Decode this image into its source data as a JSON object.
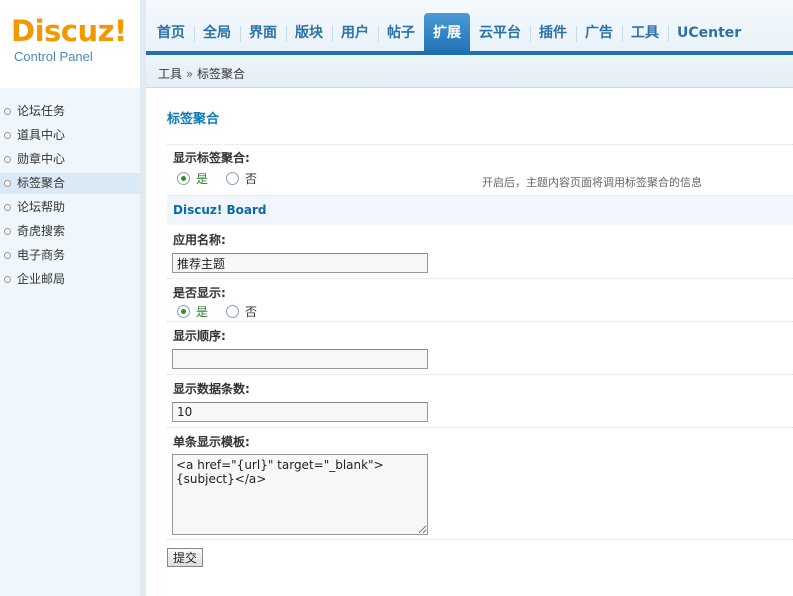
{
  "logo": {
    "word": "Discuz!",
    "sub": "Control Panel"
  },
  "nav": {
    "items": [
      {
        "label": "首页"
      },
      {
        "label": "全局"
      },
      {
        "label": "界面"
      },
      {
        "label": "版块"
      },
      {
        "label": "用户"
      },
      {
        "label": "帖子"
      },
      {
        "label": "扩展",
        "active": true
      },
      {
        "label": "云平台"
      },
      {
        "label": "插件"
      },
      {
        "label": "广告"
      },
      {
        "label": "工具"
      },
      {
        "label": "UCenter"
      }
    ]
  },
  "breadcrumb": {
    "root": "工具",
    "separator": "»",
    "current": "标签聚合"
  },
  "sidebar": {
    "items": [
      {
        "label": "论坛任务"
      },
      {
        "label": "道具中心"
      },
      {
        "label": "勋章中心"
      },
      {
        "label": "标签聚合",
        "active": true
      },
      {
        "label": "论坛帮助"
      },
      {
        "label": "奇虎搜索"
      },
      {
        "label": "电子商务"
      },
      {
        "label": "企业邮局"
      }
    ]
  },
  "main": {
    "title": "标签聚合",
    "show_tag_label": "显示标签聚合:",
    "yes_label": "是",
    "no_label": "否",
    "show_tag_tip": "开启后，主题内容页面将调用标签聚合的信息",
    "section_title": "Discuz! Board",
    "app_name_label": "应用名称:",
    "app_name_value": "推荐主题",
    "show_label": "是否显示:",
    "order_label": "显示顺序:",
    "order_value": "",
    "count_label": "显示数据条数:",
    "count_value": "10",
    "template_label": "单条显示模板:",
    "template_value": "<a href=\"{url}\" target=\"_blank\">{subject}</a>",
    "submit_label": "提交"
  },
  "colors": {
    "brand_orange": "#f39800",
    "nav_active": "#1f6fb3",
    "link_blue": "#2a72a8"
  }
}
